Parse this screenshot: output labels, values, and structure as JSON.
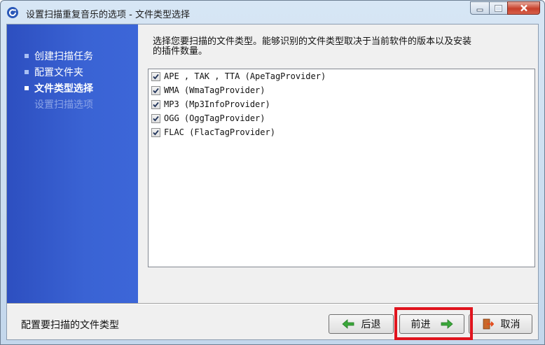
{
  "window": {
    "title": "设置扫描重复音乐的选项 - 文件类型选择"
  },
  "sidebar": {
    "steps": [
      {
        "label": "创建扫描任务",
        "state": "done"
      },
      {
        "label": "配置文件夹",
        "state": "done"
      },
      {
        "label": "文件类型选择",
        "state": "current"
      },
      {
        "label": "设置扫描选项",
        "state": "disabled"
      }
    ]
  },
  "main": {
    "description_line1": "选择您要扫描的文件类型。能够识别的文件类型取决于当前软件的版本以及安装",
    "description_line2": "的插件数量。",
    "file_types": [
      {
        "label": "APE , TAK , TTA (ApeTagProvider)",
        "checked": true
      },
      {
        "label": "WMA (WmaTagProvider)",
        "checked": true
      },
      {
        "label": "MP3 (Mp3InfoProvider)",
        "checked": true
      },
      {
        "label": "OGG (OggTagProvider)",
        "checked": true
      },
      {
        "label": "FLAC (FlacTagProvider)",
        "checked": true
      }
    ]
  },
  "footer": {
    "status_text": "配置要扫描的文件类型",
    "back_label": "后退",
    "next_label": "前进",
    "cancel_label": "取消"
  },
  "colors": {
    "sidebar": "#3a63d4",
    "highlight": "#e0141e",
    "arrow_green": "#3aa83a"
  }
}
